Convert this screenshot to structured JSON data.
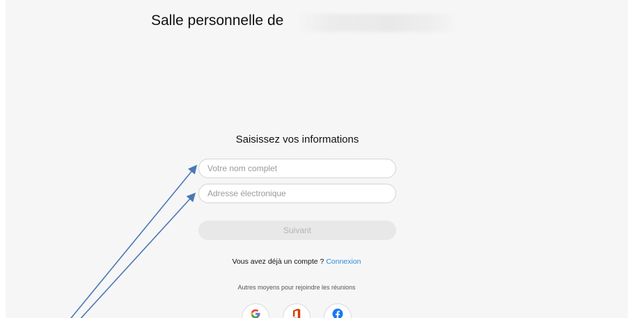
{
  "room": {
    "title": "Salle personnelle de"
  },
  "form": {
    "heading": "Saisissez vos informations",
    "name_placeholder": "Votre nom complet",
    "email_placeholder": "Adresse électronique",
    "next_label": "Suivant"
  },
  "account": {
    "prompt": "Vous avez déjà un compte ? ",
    "login_link": "Connexion"
  },
  "alt_join": {
    "label": "Autres moyens pour rejoindre les réunions",
    "providers": [
      "google-icon",
      "office-icon",
      "facebook-icon"
    ]
  },
  "colors": {
    "link": "#2c8be0",
    "annotation_arrow": "#4a78b5",
    "google_red": "#ea4335",
    "office_orange": "#d83b01",
    "facebook_blue": "#1877f2"
  }
}
